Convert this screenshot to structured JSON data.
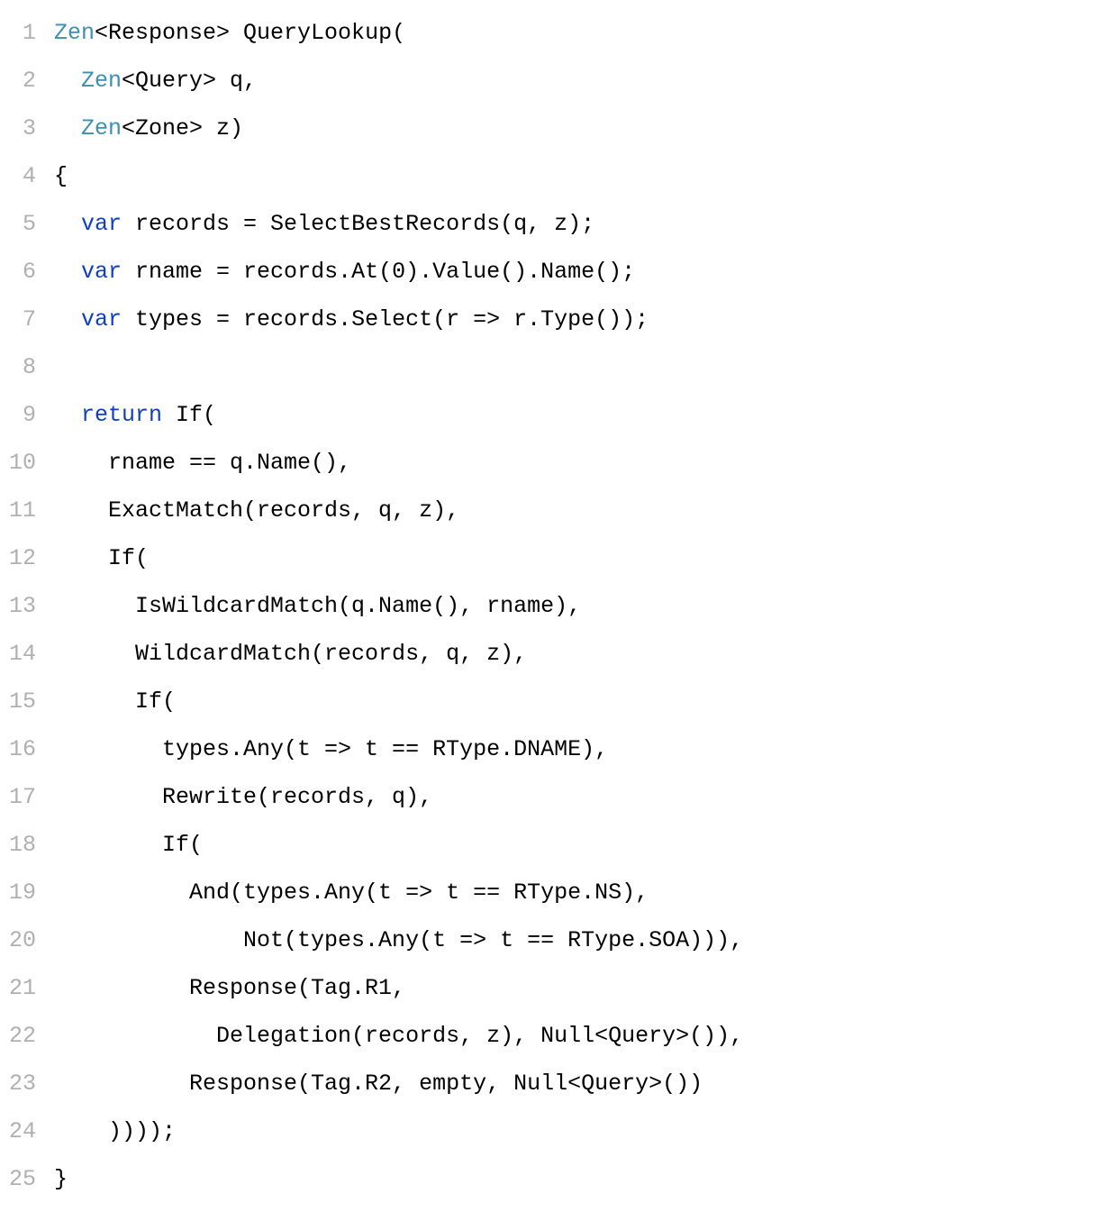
{
  "code": {
    "lines": [
      {
        "num": "1",
        "tokens": [
          {
            "t": "Zen",
            "c": "tok-type-zen"
          },
          {
            "t": "<Response> QueryLookup("
          }
        ]
      },
      {
        "num": "2",
        "tokens": [
          {
            "t": "  "
          },
          {
            "t": "Zen",
            "c": "tok-type-zen"
          },
          {
            "t": "<Query> q,"
          }
        ]
      },
      {
        "num": "3",
        "tokens": [
          {
            "t": "  "
          },
          {
            "t": "Zen",
            "c": "tok-type-zen"
          },
          {
            "t": "<Zone> z)"
          }
        ]
      },
      {
        "num": "4",
        "tokens": [
          {
            "t": "{"
          }
        ]
      },
      {
        "num": "5",
        "tokens": [
          {
            "t": "  "
          },
          {
            "t": "var",
            "c": "tok-kw"
          },
          {
            "t": " records = SelectBestRecords(q, z);"
          }
        ]
      },
      {
        "num": "6",
        "tokens": [
          {
            "t": "  "
          },
          {
            "t": "var",
            "c": "tok-kw"
          },
          {
            "t": " rname = records.At(0).Value().Name();"
          }
        ]
      },
      {
        "num": "7",
        "tokens": [
          {
            "t": "  "
          },
          {
            "t": "var",
            "c": "tok-kw"
          },
          {
            "t": " types = records.Select(r => r.Type());"
          }
        ]
      },
      {
        "num": "8",
        "tokens": [
          {
            "t": ""
          }
        ]
      },
      {
        "num": "9",
        "tokens": [
          {
            "t": "  "
          },
          {
            "t": "return",
            "c": "tok-kw"
          },
          {
            "t": " If("
          }
        ]
      },
      {
        "num": "10",
        "tokens": [
          {
            "t": "    rname == q.Name(),"
          }
        ]
      },
      {
        "num": "11",
        "tokens": [
          {
            "t": "    ExactMatch(records, q, z),"
          }
        ]
      },
      {
        "num": "12",
        "tokens": [
          {
            "t": "    If("
          }
        ]
      },
      {
        "num": "13",
        "tokens": [
          {
            "t": "      IsWildcardMatch(q.Name(), rname),"
          }
        ]
      },
      {
        "num": "14",
        "tokens": [
          {
            "t": "      WildcardMatch(records, q, z),"
          }
        ]
      },
      {
        "num": "15",
        "tokens": [
          {
            "t": "      If("
          }
        ]
      },
      {
        "num": "16",
        "tokens": [
          {
            "t": "        types.Any(t => t == RType.DNAME),"
          }
        ]
      },
      {
        "num": "17",
        "tokens": [
          {
            "t": "        Rewrite(records, q),"
          }
        ]
      },
      {
        "num": "18",
        "tokens": [
          {
            "t": "        If("
          }
        ]
      },
      {
        "num": "19",
        "tokens": [
          {
            "t": "          And(types.Any(t => t == RType.NS),"
          }
        ]
      },
      {
        "num": "20",
        "tokens": [
          {
            "t": "              Not(types.Any(t => t == RType.SOA))),"
          }
        ]
      },
      {
        "num": "21",
        "tokens": [
          {
            "t": "          Response(Tag.R1,"
          }
        ]
      },
      {
        "num": "22",
        "tokens": [
          {
            "t": "            Delegation(records, z), Null<Query>()),"
          }
        ]
      },
      {
        "num": "23",
        "tokens": [
          {
            "t": "          Response(Tag.R2, empty, Null<Query>())"
          }
        ]
      },
      {
        "num": "24",
        "tokens": [
          {
            "t": "    ))));"
          }
        ]
      },
      {
        "num": "25",
        "tokens": [
          {
            "t": "}"
          }
        ]
      }
    ]
  }
}
